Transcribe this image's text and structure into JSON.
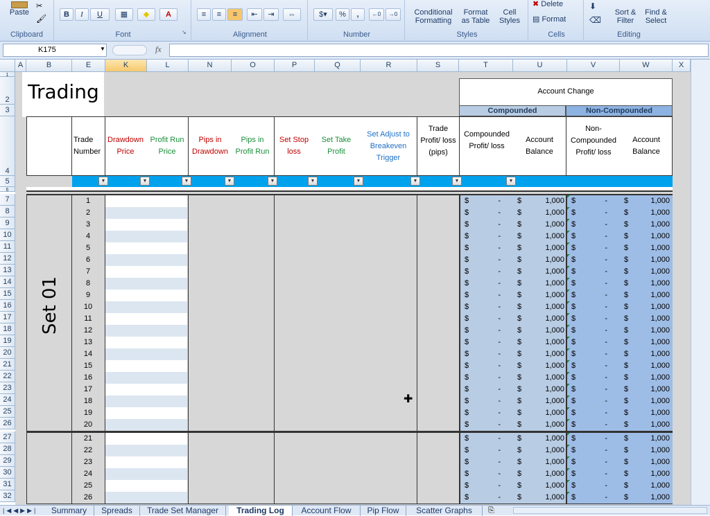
{
  "ribbon": {
    "groups": {
      "clipboard": "Clipboard",
      "font": "Font",
      "alignment": "Alignment",
      "number": "Number",
      "styles": "Styles",
      "cells": "Cells",
      "editing": "Editing"
    },
    "paste": "Paste",
    "bold": "B",
    "italic": "I",
    "underline": "U",
    "font_color_letter": "A",
    "percent": "%",
    "comma": ",",
    "increase_decimal": ".0 .00",
    "decrease_decimal": ".00 →.0",
    "conditional_formatting_1": "Conditional",
    "conditional_formatting_2": "Formatting",
    "format_as_table_1": "Format",
    "format_as_table_2": "as Table",
    "cell_styles_1": "Cell",
    "cell_styles_2": "Styles",
    "delete": "Delete",
    "format": "Format",
    "sort_filter_1": "Sort &",
    "sort_filter_2": "Filter",
    "find_select_1": "Find &",
    "find_select_2": "Select"
  },
  "formula_bar": {
    "name_box": "K175",
    "fx": "fx",
    "content": ""
  },
  "columns": [
    "A",
    "B",
    "E",
    "K",
    "L",
    "N",
    "O",
    "P",
    "Q",
    "R",
    "S",
    "T",
    "U",
    "V",
    "W",
    "X"
  ],
  "rows": [
    "1",
    "2",
    "3",
    "4",
    "5",
    "6",
    "7",
    "8",
    "9",
    "10",
    "11",
    "12",
    "13",
    "14",
    "15",
    "16",
    "17",
    "18",
    "19",
    "20",
    "21",
    "22",
    "23",
    "24",
    "25",
    "26",
    "27",
    "28",
    "29",
    "30",
    "31",
    "32"
  ],
  "sheet": {
    "title": "Trading",
    "account_change": "Account Change",
    "compounded": "Compounded",
    "non_compounded": "Non-Compounded",
    "headers": {
      "trade_number": "Trade Number",
      "drawdown_price": "Drawdown Price",
      "profit_run_price": "Profit Run Price",
      "pips_in_drawdown": "Pips in Drawdown",
      "pips_in_profit_run": "Pips in Profit Run",
      "set_stop_loss": "Set Stop loss",
      "set_take_profit": "Set Take Profit",
      "set_adjust": "Set Adjust to Breakeven Trigger",
      "trade_profit": "Trade Profit/ loss (pips)",
      "compounded_pl": "Compounded Profit/ loss",
      "account_balance": "Account Balance",
      "non_compounded_pl": "Non-Compounded Profit/ loss",
      "account_balance_2": "Account Balance"
    },
    "set_label": "Set 01",
    "trade_numbers": [
      "1",
      "2",
      "3",
      "4",
      "5",
      "6",
      "7",
      "8",
      "9",
      "10",
      "11",
      "12",
      "13",
      "14",
      "15",
      "16",
      "17",
      "18",
      "19",
      "20",
      "21",
      "22",
      "23",
      "24",
      "25",
      "26"
    ],
    "currency": "$",
    "dash": "-",
    "balance": "1,000"
  },
  "tabs": [
    "Summary",
    "Spreads",
    "Trade Set Manager",
    "Trading Log",
    "Account Flow",
    "Pip Flow",
    "Scatter Graphs"
  ],
  "active_tab": "Trading Log",
  "colors": {
    "accent_blue": "#00a2ed",
    "header_blue": "#b8cce4",
    "compound_fill": "#b8cce4",
    "tab_text": "#1e3a66"
  }
}
